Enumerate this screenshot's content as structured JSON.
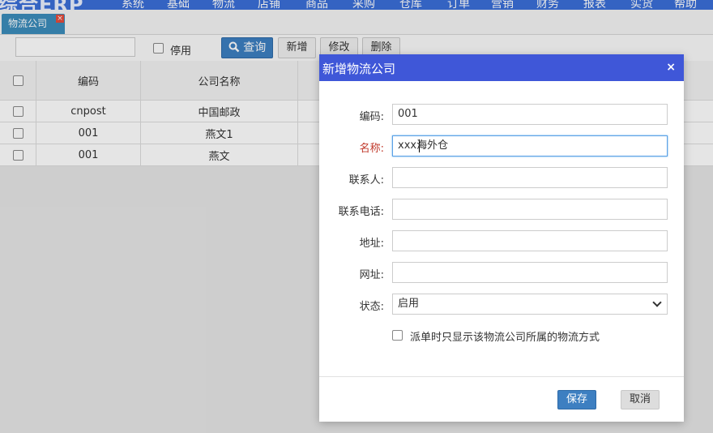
{
  "nav": {
    "brand": "综合ERP",
    "items": [
      "系统",
      "基础",
      "物流",
      "店铺",
      "商品",
      "采购",
      "仓库",
      "订单",
      "营销",
      "财务",
      "报表",
      "实货",
      "帮助"
    ]
  },
  "tab": {
    "label": "物流公司",
    "close": "×"
  },
  "toolbar": {
    "search_value": "",
    "disabled_label": "停用",
    "query_label": "查询",
    "add_label": "新增",
    "edit_label": "修改",
    "delete_label": "删除"
  },
  "table": {
    "columns": [
      "编码",
      "公司名称"
    ],
    "rows": [
      {
        "code": "cnpost",
        "name": "中国邮政"
      },
      {
        "code": "001",
        "name": "燕文1"
      },
      {
        "code": "001",
        "name": "燕文"
      }
    ]
  },
  "dialog": {
    "title": "新增物流公司",
    "close": "×",
    "fields": {
      "code": {
        "label": "编码:",
        "value": "001"
      },
      "name": {
        "label": "名称:",
        "value": "xxx海外仓"
      },
      "contact": {
        "label": "联系人:",
        "value": ""
      },
      "phone": {
        "label": "联系电话:",
        "value": ""
      },
      "address": {
        "label": "地址:",
        "value": ""
      },
      "website": {
        "label": "网址:",
        "value": ""
      },
      "status": {
        "label": "状态:",
        "value": "启用"
      }
    },
    "only_show_label": "派单时只显示该物流公司所属的物流方式",
    "save_label": "保存",
    "cancel_label": "取消"
  },
  "colors": {
    "nav": "#3a6fd8",
    "dialog_header": "#3f57d8",
    "primary_button": "#3d7fc1",
    "required_label": "#c0392b"
  }
}
